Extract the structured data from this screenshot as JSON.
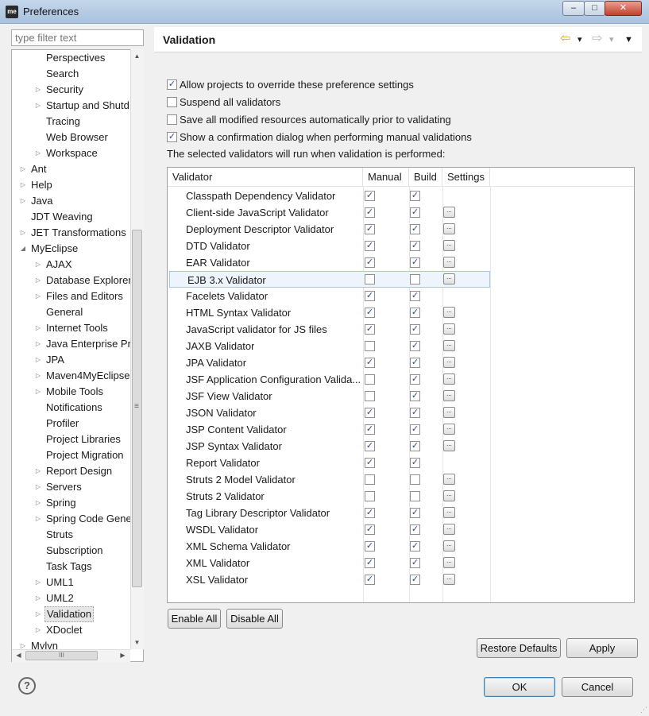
{
  "window": {
    "title": "Preferences",
    "app_icon_text": "me",
    "minimize": "‒",
    "maximize": "□",
    "close": "✕"
  },
  "filter": {
    "placeholder": "type filter text"
  },
  "tree": {
    "items": [
      {
        "label": "Perspectives",
        "level": 1,
        "arrow": ""
      },
      {
        "label": "Search",
        "level": 1,
        "arrow": ""
      },
      {
        "label": "Security",
        "level": 1,
        "arrow": "▷"
      },
      {
        "label": "Startup and Shutd",
        "level": 1,
        "arrow": "▷"
      },
      {
        "label": "Tracing",
        "level": 1,
        "arrow": ""
      },
      {
        "label": "Web Browser",
        "level": 1,
        "arrow": ""
      },
      {
        "label": "Workspace",
        "level": 1,
        "arrow": "▷"
      },
      {
        "label": "Ant",
        "level": 0,
        "arrow": "▷"
      },
      {
        "label": "Help",
        "level": 0,
        "arrow": "▷"
      },
      {
        "label": "Java",
        "level": 0,
        "arrow": "▷"
      },
      {
        "label": "JDT Weaving",
        "level": 0,
        "arrow": ""
      },
      {
        "label": "JET Transformations",
        "level": 0,
        "arrow": "▷"
      },
      {
        "label": "MyEclipse",
        "level": 0,
        "arrow": "◢"
      },
      {
        "label": "AJAX",
        "level": 1,
        "arrow": "▷"
      },
      {
        "label": "Database Explorer",
        "level": 1,
        "arrow": "▷"
      },
      {
        "label": "Files and Editors",
        "level": 1,
        "arrow": "▷"
      },
      {
        "label": "General",
        "level": 1,
        "arrow": ""
      },
      {
        "label": "Internet Tools",
        "level": 1,
        "arrow": "▷"
      },
      {
        "label": "Java Enterprise Pr",
        "level": 1,
        "arrow": "▷"
      },
      {
        "label": "JPA",
        "level": 1,
        "arrow": "▷"
      },
      {
        "label": "Maven4MyEclipse",
        "level": 1,
        "arrow": "▷"
      },
      {
        "label": "Mobile Tools",
        "level": 1,
        "arrow": "▷"
      },
      {
        "label": "Notifications",
        "level": 1,
        "arrow": ""
      },
      {
        "label": "Profiler",
        "level": 1,
        "arrow": ""
      },
      {
        "label": "Project Libraries",
        "level": 1,
        "arrow": ""
      },
      {
        "label": "Project Migration",
        "level": 1,
        "arrow": ""
      },
      {
        "label": "Report Design",
        "level": 1,
        "arrow": "▷"
      },
      {
        "label": "Servers",
        "level": 1,
        "arrow": "▷"
      },
      {
        "label": "Spring",
        "level": 1,
        "arrow": "▷"
      },
      {
        "label": "Spring Code Gene",
        "level": 1,
        "arrow": "▷"
      },
      {
        "label": "Struts",
        "level": 1,
        "arrow": ""
      },
      {
        "label": "Subscription",
        "level": 1,
        "arrow": ""
      },
      {
        "label": "Task Tags",
        "level": 1,
        "arrow": ""
      },
      {
        "label": "UML1",
        "level": 1,
        "arrow": "▷"
      },
      {
        "label": "UML2",
        "level": 1,
        "arrow": "▷"
      },
      {
        "label": "Validation",
        "level": 1,
        "arrow": "▷",
        "selected": true
      },
      {
        "label": "XDoclet",
        "level": 1,
        "arrow": "▷"
      },
      {
        "label": "Mylyn",
        "level": 0,
        "arrow": "▷"
      }
    ],
    "vscroll_grip": "≡",
    "hscroll_grip": "III",
    "up_arrow": "▲",
    "down_arrow": "▼",
    "left_arrow": "◀",
    "right_arrow": "▶"
  },
  "page": {
    "title": "Validation",
    "nav": {
      "back": "⇦",
      "back_menu": "▾",
      "forward": "⇨",
      "forward_menu": "▾",
      "view_menu": "▼"
    },
    "options": [
      {
        "label": "Allow projects to override these preference settings",
        "checked": true
      },
      {
        "label": "Suspend all validators",
        "checked": false
      },
      {
        "label": "Save all modified resources automatically prior to validating",
        "checked": false
      },
      {
        "label": "Show a confirmation dialog when performing manual validations",
        "checked": true
      }
    ],
    "info_text": "The selected validators will run when validation is performed:",
    "table": {
      "headers": [
        "Validator",
        "Manual",
        "Build",
        "Settings"
      ],
      "settings_glyph": "...",
      "rows": [
        {
          "name": "Classpath Dependency Validator",
          "manual": true,
          "build": true,
          "settings": false
        },
        {
          "name": "Client-side JavaScript Validator",
          "manual": true,
          "build": true,
          "settings": true
        },
        {
          "name": "Deployment Descriptor Validator",
          "manual": true,
          "build": true,
          "settings": true
        },
        {
          "name": "DTD Validator",
          "manual": true,
          "build": true,
          "settings": true
        },
        {
          "name": "EAR Validator",
          "manual": true,
          "build": true,
          "settings": true
        },
        {
          "name": "EJB 3.x Validator",
          "manual": false,
          "build": false,
          "settings": true,
          "selected": true
        },
        {
          "name": "Facelets Validator",
          "manual": true,
          "build": true,
          "settings": false
        },
        {
          "name": "HTML Syntax Validator",
          "manual": true,
          "build": true,
          "settings": true
        },
        {
          "name": "JavaScript validator for JS files",
          "manual": true,
          "build": true,
          "settings": true
        },
        {
          "name": "JAXB Validator",
          "manual": false,
          "build": true,
          "settings": true
        },
        {
          "name": "JPA Validator",
          "manual": true,
          "build": true,
          "settings": true
        },
        {
          "name": "JSF Application Configuration Valida...",
          "manual": false,
          "build": true,
          "settings": true
        },
        {
          "name": "JSF View Validator",
          "manual": false,
          "build": true,
          "settings": true
        },
        {
          "name": "JSON Validator",
          "manual": true,
          "build": true,
          "settings": true
        },
        {
          "name": "JSP Content Validator",
          "manual": true,
          "build": true,
          "settings": true
        },
        {
          "name": "JSP Syntax Validator",
          "manual": true,
          "build": true,
          "settings": true
        },
        {
          "name": "Report Validator",
          "manual": true,
          "build": true,
          "settings": false
        },
        {
          "name": "Struts 2 Model Validator",
          "manual": false,
          "build": false,
          "settings": true
        },
        {
          "name": "Struts 2 Validator",
          "manual": false,
          "build": false,
          "settings": true
        },
        {
          "name": "Tag Library Descriptor Validator",
          "manual": true,
          "build": true,
          "settings": true
        },
        {
          "name": "WSDL Validator",
          "manual": true,
          "build": true,
          "settings": true
        },
        {
          "name": "XML Schema Validator",
          "manual": true,
          "build": true,
          "settings": true
        },
        {
          "name": "XML Validator",
          "manual": true,
          "build": true,
          "settings": true
        },
        {
          "name": "XSL Validator",
          "manual": true,
          "build": true,
          "settings": true
        }
      ]
    },
    "buttons": {
      "enable_all": "Enable All",
      "disable_all": "Disable All",
      "restore_defaults": "Restore Defaults",
      "apply": "Apply"
    }
  },
  "footer": {
    "help": "?",
    "ok": "OK",
    "cancel": "Cancel",
    "grip": "⋰"
  },
  "colors": {
    "title_bar": "#b6cbe3",
    "close_button": "#c2402c",
    "selection": "#eef4fc",
    "check": "#2b4a8a"
  }
}
